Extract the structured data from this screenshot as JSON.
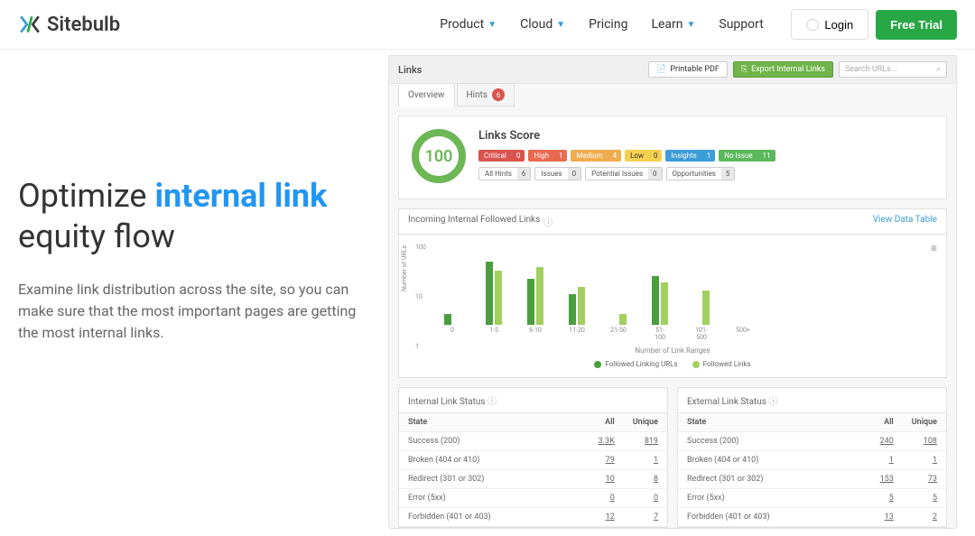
{
  "header": {
    "brand": "Sitebulb",
    "nav": [
      "Product",
      "Cloud",
      "Pricing",
      "Learn",
      "Support"
    ],
    "login": "Login",
    "trial": "Free Trial"
  },
  "hero": {
    "t1": "Optimize ",
    "t2": "internal link",
    "t3": " equity flow",
    "body": "Examine link distribution across the site, so you can make sure that the most important pages are getting the most internal links."
  },
  "panel": {
    "title": "Links",
    "print": "Printable PDF",
    "export": "Export Internal Links",
    "search_ph": "Search URLs...",
    "tab1": "Overview",
    "tab2": "Hints",
    "tab2_badge": "6"
  },
  "score": {
    "value": "100",
    "title": "Links Score",
    "severity": [
      {
        "cls": "p-critical",
        "label": "Critical",
        "count": "0"
      },
      {
        "cls": "p-high",
        "label": "High",
        "count": "1"
      },
      {
        "cls": "p-medium",
        "label": "Medium",
        "count": "4"
      },
      {
        "cls": "p-low",
        "label": "Low",
        "count": "0"
      },
      {
        "cls": "p-insights",
        "label": "Insights",
        "count": "1"
      },
      {
        "cls": "p-noissue",
        "label": "No Issue",
        "count": "11"
      }
    ],
    "filters": [
      {
        "label": "All Hints",
        "count": "6"
      },
      {
        "label": "Issues",
        "count": "0"
      },
      {
        "label": "Potential Issues",
        "count": "0"
      },
      {
        "label": "Opportunities",
        "count": "5"
      }
    ]
  },
  "chart": {
    "title": "Incoming Internal Followed Links",
    "link": "View Data Table",
    "ylabel": "Number of URLs",
    "xlabel": "Number of Link Ranges",
    "yticks": [
      "100",
      "10",
      "1"
    ],
    "legend1": "Followed Linking URLs",
    "legend2": "Followed Links",
    "cats": [
      "0",
      "1-5",
      "6-10",
      "11-20",
      "21-50",
      "51-100",
      "101-500",
      "500+"
    ]
  },
  "chart_data": {
    "type": "bar",
    "categories": [
      "0",
      "1-5",
      "6-10",
      "11-20",
      "21-50",
      "51-100",
      "101-500",
      "500+"
    ],
    "series": [
      {
        "name": "Followed Linking URLs",
        "values": [
          1,
          55,
          18,
          6,
          0,
          22,
          0,
          0
        ]
      },
      {
        "name": "Followed Links",
        "values": [
          0,
          30,
          38,
          10,
          1,
          14,
          8,
          0
        ]
      }
    ],
    "xlabel": "Number of Link Ranges",
    "ylabel": "Number of URLs",
    "yscale": "log",
    "ylim": [
      1,
      100
    ]
  },
  "tables": {
    "internal": {
      "title": "Internal Link Status",
      "cols": [
        "State",
        "All",
        "Unique"
      ],
      "rows": [
        [
          "Success (200)",
          "3.3K",
          "819"
        ],
        [
          "Broken (404 or 410)",
          "79",
          "1"
        ],
        [
          "Redirect (301 or 302)",
          "10",
          "8"
        ],
        [
          "Error (5xx)",
          "0",
          "0"
        ],
        [
          "Forbidden (401 or 403)",
          "12",
          "7"
        ]
      ]
    },
    "external": {
      "title": "External Link Status",
      "cols": [
        "State",
        "All",
        "Unique"
      ],
      "rows": [
        [
          "Success (200)",
          "240",
          "108"
        ],
        [
          "Broken (404 or 410)",
          "1",
          "1"
        ],
        [
          "Redirect (301 or 302)",
          "153",
          "73"
        ],
        [
          "Error (5xx)",
          "5",
          "5"
        ],
        [
          "Forbidden (401 or 403)",
          "13",
          "2"
        ]
      ]
    }
  }
}
